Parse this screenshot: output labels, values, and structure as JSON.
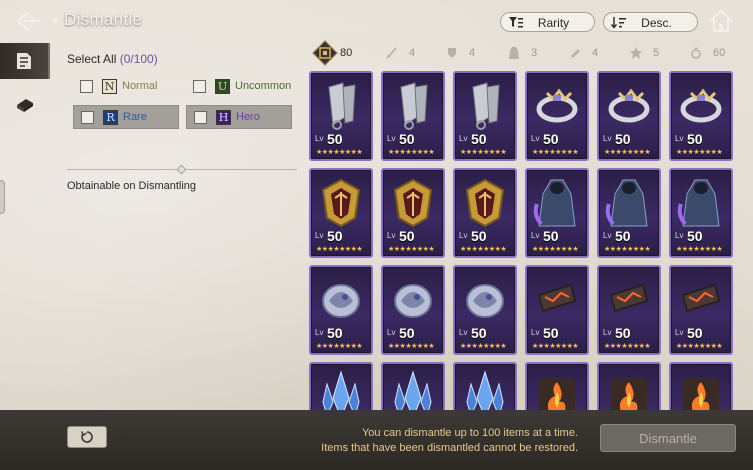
{
  "header": {
    "title": "Dismantle",
    "sort_label": "Rarity",
    "order_label": "Desc."
  },
  "filters": {
    "select_all_label": "Select All",
    "select_all_count": "(0/100)",
    "grades": [
      {
        "letter": "N",
        "name": "Normal",
        "color": "#8a7a4c",
        "shaded": false
      },
      {
        "letter": "U",
        "name": "Uncommon",
        "color": "#4d6a2e",
        "shaded": false
      },
      {
        "letter": "R",
        "name": "Rare",
        "color": "#2e5aa6",
        "shaded": true
      },
      {
        "letter": "H",
        "name": "Hero",
        "color": "#6a3fa6",
        "shaded": true
      }
    ],
    "obtainable_label": "Obtainable on Dismantling"
  },
  "categories": [
    {
      "icon": "all-items-icon",
      "count": "80",
      "active": true
    },
    {
      "icon": "weapon-icon",
      "count": "4",
      "active": false
    },
    {
      "icon": "armor-icon",
      "count": "4",
      "active": false
    },
    {
      "icon": "cloak-icon",
      "count": "3",
      "active": false
    },
    {
      "icon": "gauntlet-icon",
      "count": "4",
      "active": false
    },
    {
      "icon": "accessory-icon",
      "count": "5",
      "active": false
    },
    {
      "icon": "ring-icon",
      "count": "60",
      "active": false
    }
  ],
  "items": [
    {
      "kind": "gauntlet",
      "lv_prefix": "Lv",
      "level": "50",
      "stars": "★★★★★★★★"
    },
    {
      "kind": "gauntlet",
      "lv_prefix": "Lv",
      "level": "50",
      "stars": "★★★★★★★★"
    },
    {
      "kind": "gauntlet",
      "lv_prefix": "Lv",
      "level": "50",
      "stars": "★★★★★★★★"
    },
    {
      "kind": "ring",
      "lv_prefix": "Lv",
      "level": "50",
      "stars": "★★★★★★★★"
    },
    {
      "kind": "ring",
      "lv_prefix": "Lv",
      "level": "50",
      "stars": "★★★★★★★★"
    },
    {
      "kind": "ring",
      "lv_prefix": "Lv",
      "level": "50",
      "stars": "★★★★★★★★"
    },
    {
      "kind": "emblem",
      "lv_prefix": "Lv",
      "level": "50",
      "stars": "★★★★★★★★"
    },
    {
      "kind": "emblem",
      "lv_prefix": "Lv",
      "level": "50",
      "stars": "★★★★★★★★"
    },
    {
      "kind": "emblem",
      "lv_prefix": "Lv",
      "level": "50",
      "stars": "★★★★★★★★"
    },
    {
      "kind": "cloak",
      "lv_prefix": "Lv",
      "level": "50",
      "stars": "★★★★★★★★"
    },
    {
      "kind": "cloak",
      "lv_prefix": "Lv",
      "level": "50",
      "stars": "★★★★★★★★"
    },
    {
      "kind": "cloak",
      "lv_prefix": "Lv",
      "level": "50",
      "stars": "★★★★★★★★"
    },
    {
      "kind": "dragon",
      "lv_prefix": "Lv",
      "level": "50",
      "stars": "★★★★★★★★"
    },
    {
      "kind": "dragon",
      "lv_prefix": "Lv",
      "level": "50",
      "stars": "★★★★★★★★"
    },
    {
      "kind": "dragon",
      "lv_prefix": "Lv",
      "level": "50",
      "stars": "★★★★★★★★"
    },
    {
      "kind": "belt",
      "lv_prefix": "Lv",
      "level": "50",
      "stars": "★★★★★★★★"
    },
    {
      "kind": "belt",
      "lv_prefix": "Lv",
      "level": "50",
      "stars": "★★★★★★★★"
    },
    {
      "kind": "belt",
      "lv_prefix": "Lv",
      "level": "50",
      "stars": "★★★★★★★★"
    },
    {
      "kind": "crystal",
      "lv_prefix": "",
      "level": "",
      "stars": ""
    },
    {
      "kind": "crystal",
      "lv_prefix": "",
      "level": "",
      "stars": ""
    },
    {
      "kind": "crystal",
      "lv_prefix": "",
      "level": "",
      "stars": ""
    },
    {
      "kind": "fire",
      "lv_prefix": "",
      "level": "",
      "stars": ""
    },
    {
      "kind": "fire",
      "lv_prefix": "",
      "level": "",
      "stars": ""
    },
    {
      "kind": "fire",
      "lv_prefix": "",
      "level": "",
      "stars": ""
    }
  ],
  "footer": {
    "notice_line1": "You can dismantle up to 100 items at a time.",
    "notice_line2": "Items that have been dismantled cannot be restored.",
    "dismantle_label": "Dismantle"
  },
  "colors": {
    "card_border": "#8c6fc2",
    "accent_count": "#6e4fa3",
    "notice_text": "#e6c98f"
  }
}
